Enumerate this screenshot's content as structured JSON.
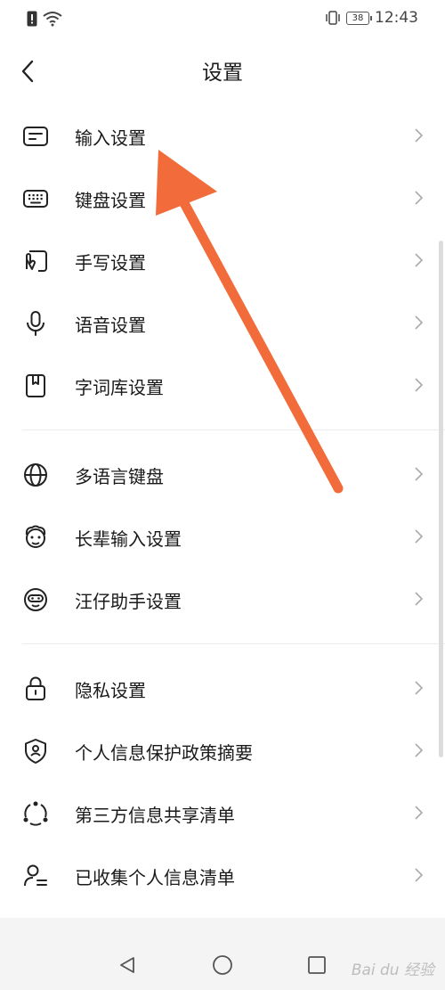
{
  "status_bar": {
    "time": "12:43",
    "battery": "38",
    "icons": [
      "sim-alert-icon",
      "wifi-icon",
      "vibrate-icon",
      "battery-icon"
    ]
  },
  "header": {
    "title": "设置",
    "back_icon": "chevron-left-icon"
  },
  "menu": {
    "section1": [
      {
        "label": "输入设置",
        "icon": "input-settings-icon"
      },
      {
        "label": "键盘设置",
        "icon": "keyboard-icon"
      },
      {
        "label": "手写设置",
        "icon": "handwriting-icon"
      },
      {
        "label": "语音设置",
        "icon": "microphone-icon"
      },
      {
        "label": "字词库设置",
        "icon": "dictionary-icon"
      }
    ],
    "section2": [
      {
        "label": "多语言键盘",
        "icon": "globe-icon"
      },
      {
        "label": "长辈输入设置",
        "icon": "elder-face-icon"
      },
      {
        "label": "汪仔助手设置",
        "icon": "assistant-face-icon"
      }
    ],
    "section3": [
      {
        "label": "隐私设置",
        "icon": "lock-icon"
      },
      {
        "label": "个人信息保护政策摘要",
        "icon": "shield-user-icon"
      },
      {
        "label": "第三方信息共享清单",
        "icon": "share-circle-icon"
      },
      {
        "label": "已收集个人信息清单",
        "icon": "user-list-icon"
      }
    ]
  },
  "nav_bar": {
    "icons": [
      "nav-back-icon",
      "nav-home-icon",
      "nav-recents-icon"
    ]
  },
  "annotation": {
    "arrow_color": "#f26b3a"
  },
  "watermark": "Bai du 经验"
}
